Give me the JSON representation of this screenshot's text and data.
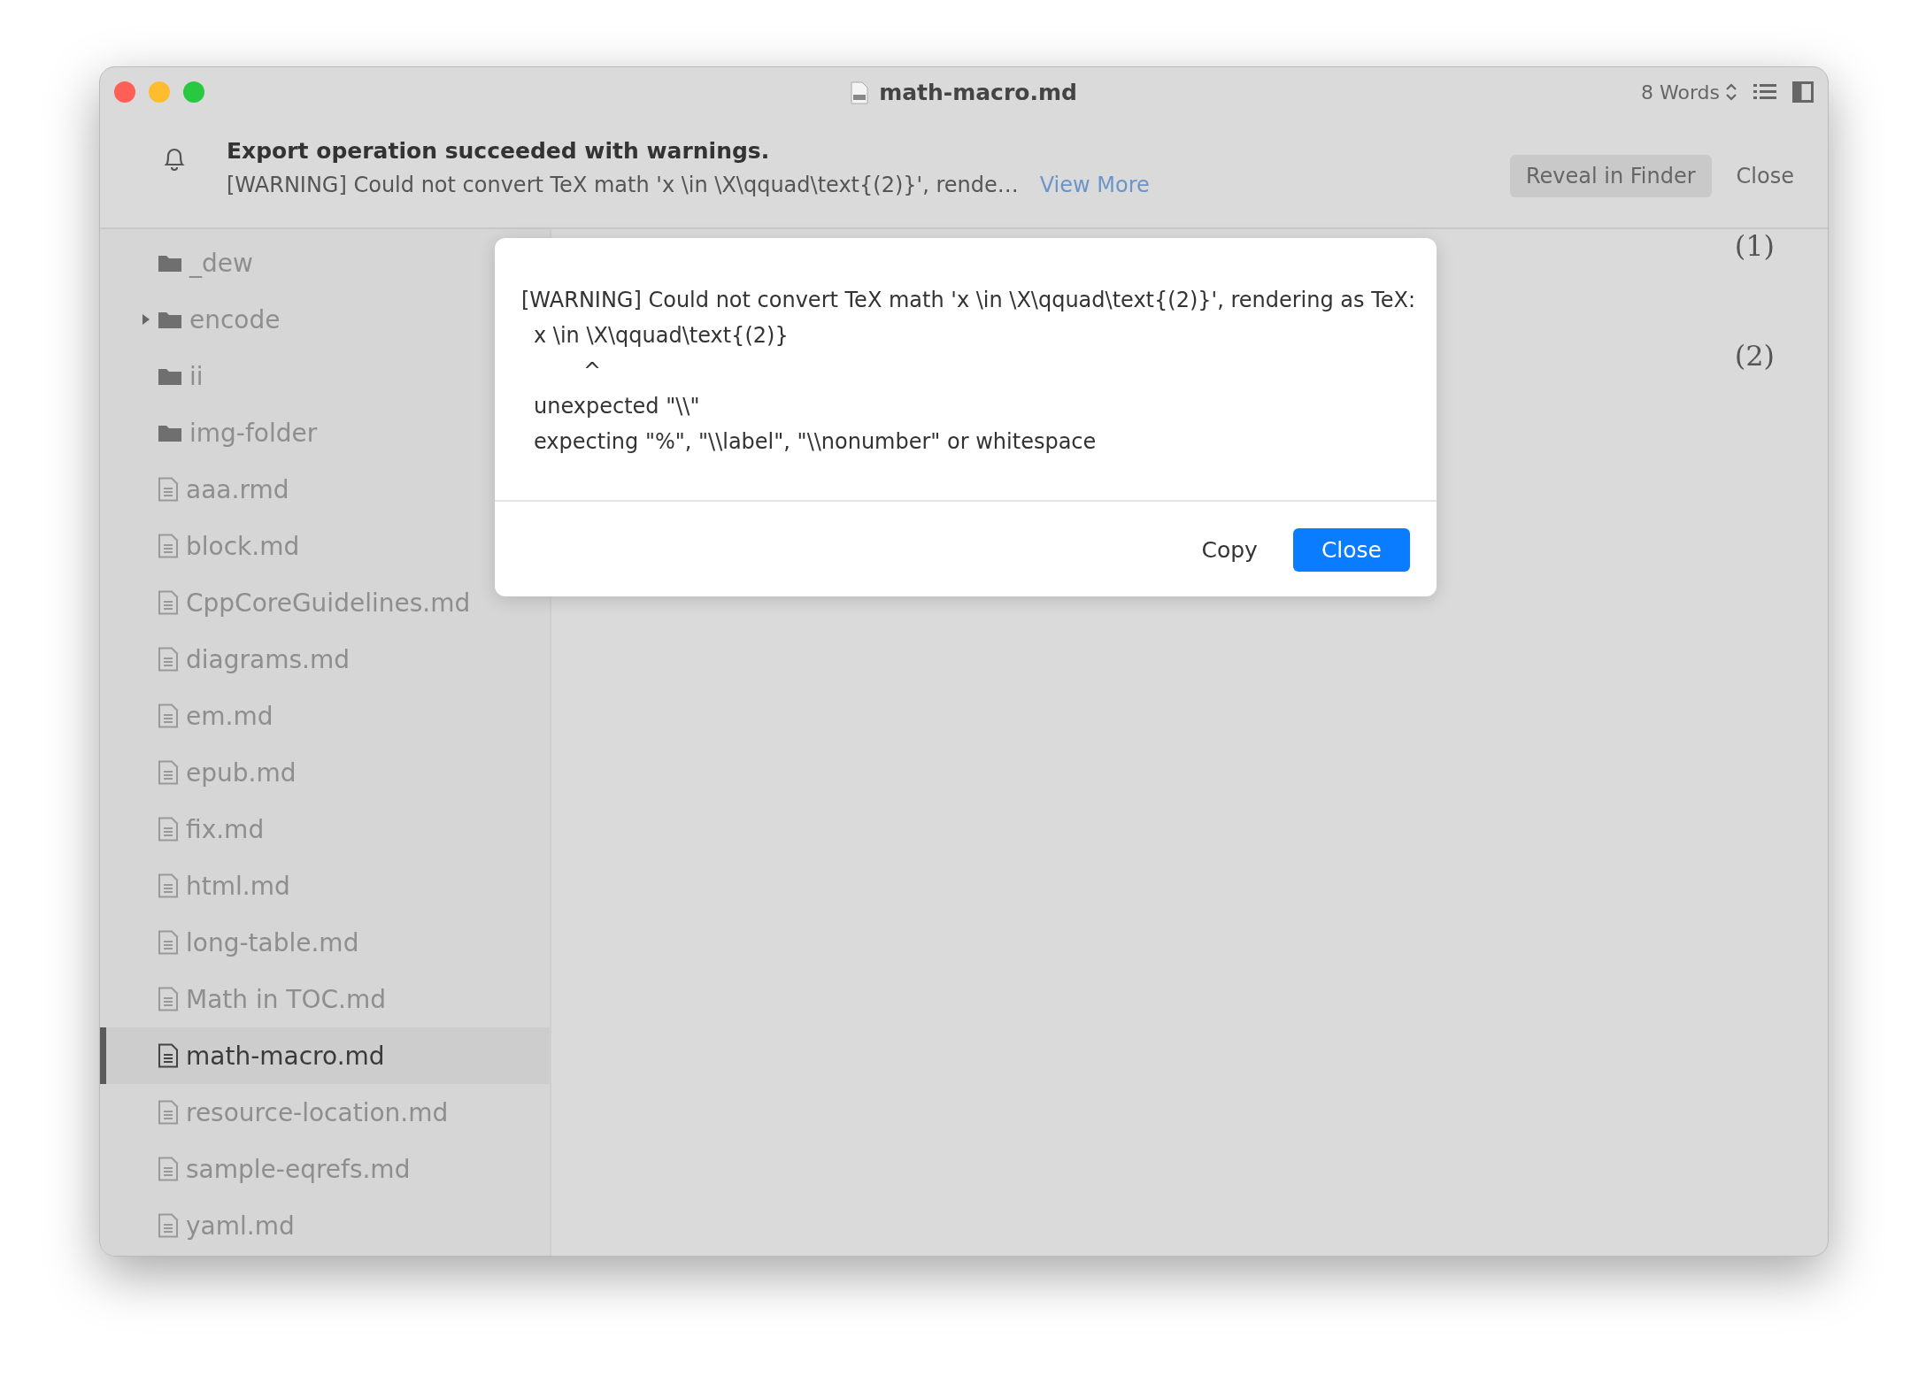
{
  "window": {
    "title": "math-macro.md",
    "word_count": "8 Words"
  },
  "notification": {
    "title": "Export operation succeeded with warnings.",
    "message": "[WARNING] Could not convert TeX math 'x \\in \\X\\qquad\\text{(2)}', rende…",
    "link": "View More",
    "buttons": [
      "Reveal in Finder",
      "Close"
    ]
  },
  "sidebar": {
    "items": [
      {
        "name": "_dew",
        "kind": "folder",
        "expandable": false,
        "selected": false
      },
      {
        "name": "encode",
        "kind": "folder",
        "expandable": true,
        "selected": false
      },
      {
        "name": "ii",
        "kind": "folder",
        "expandable": false,
        "selected": false
      },
      {
        "name": "img-folder",
        "kind": "folder",
        "expandable": false,
        "selected": false
      },
      {
        "name": "aaa.rmd",
        "kind": "file",
        "selected": false
      },
      {
        "name": "block.md",
        "kind": "file",
        "selected": false
      },
      {
        "name": "CppCoreGuidelines.md",
        "kind": "file",
        "selected": false
      },
      {
        "name": "diagrams.md",
        "kind": "file",
        "selected": false
      },
      {
        "name": "em.md",
        "kind": "file",
        "selected": false
      },
      {
        "name": "epub.md",
        "kind": "file",
        "selected": false
      },
      {
        "name": "fix.md",
        "kind": "file",
        "selected": false
      },
      {
        "name": "html.md",
        "kind": "file",
        "selected": false
      },
      {
        "name": "long-table.md",
        "kind": "file",
        "selected": false
      },
      {
        "name": "Math in TOC.md",
        "kind": "file",
        "selected": false
      },
      {
        "name": "math-macro.md",
        "kind": "file",
        "selected": true
      },
      {
        "name": "resource-location.md",
        "kind": "file",
        "selected": false
      },
      {
        "name": "sample-eqrefs.md",
        "kind": "file",
        "selected": false
      },
      {
        "name": "yaml.md",
        "kind": "file",
        "selected": false
      }
    ]
  },
  "editor": {
    "equation_numbers": [
      "(1)",
      "(2)"
    ]
  },
  "dialog": {
    "lines": [
      {
        "kind": "header",
        "text": "[WARNING] Could not convert TeX math 'x \\in \\X\\qquad\\text{(2)}', rendering as TeX:"
      },
      {
        "kind": "source",
        "text": "x \\in \\X\\qquad\\text{(2)}"
      },
      {
        "kind": "pointer",
        "text": "^"
      },
      {
        "kind": "message",
        "text": "unexpected \"\\\\\""
      },
      {
        "kind": "message",
        "text": "expecting \"%\", \"\\\\label\", \"\\\\nonumber\" or whitespace"
      }
    ],
    "buttons": [
      {
        "label": "Copy",
        "primary": false
      },
      {
        "label": "Close",
        "primary": true
      }
    ]
  }
}
